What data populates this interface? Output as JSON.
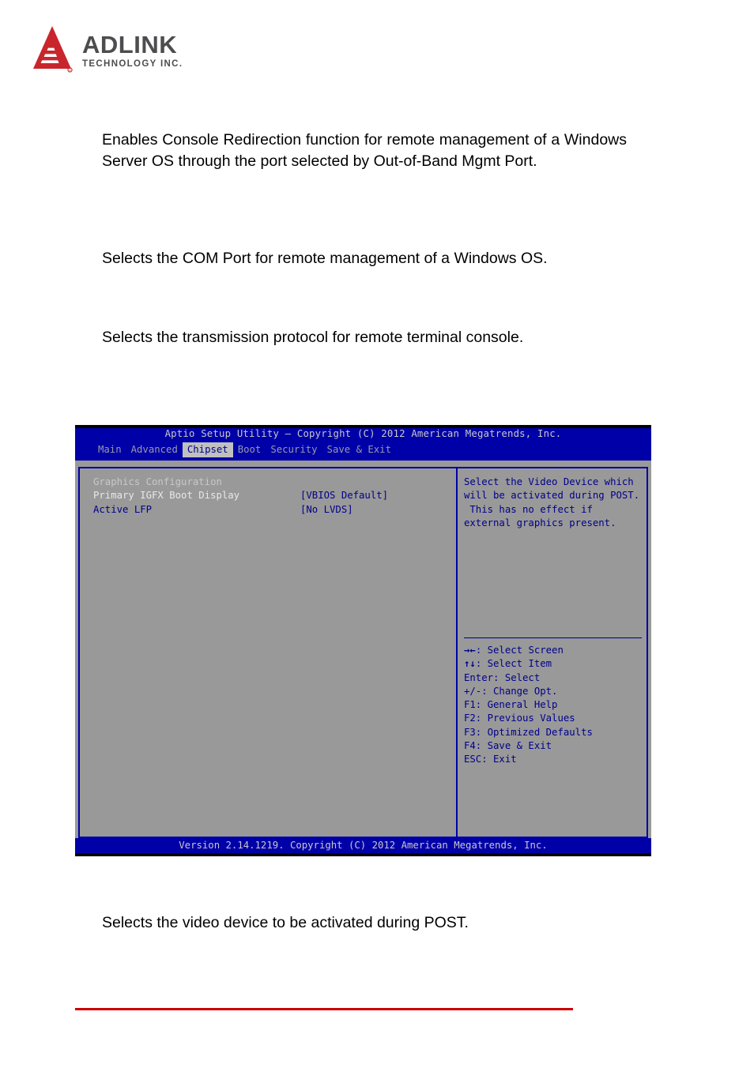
{
  "header": {
    "logo_name": "ADLINK",
    "logo_sub": "TECHNOLOGY INC.",
    "logo_icon": "adlink-triangle-logo",
    "logo_color": "#c8262c"
  },
  "descriptions": {
    "p1": "Enables Console Redirection function for remote management of a Windows Server OS through the port selected by Out-of-Band Mgmt Port.",
    "p2": "Selects the COM Port for remote management of a Windows OS.",
    "p3": "Selects the transmission protocol for remote terminal console.",
    "p4": "Selects the video device to be activated during POST."
  },
  "bios": {
    "title": "Aptio Setup Utility – Copyright (C) 2012 American Megatrends, Inc.",
    "menu": [
      {
        "label": "Main",
        "active": false
      },
      {
        "label": "Advanced",
        "active": false
      },
      {
        "label": "Chipset",
        "active": true
      },
      {
        "label": "Boot",
        "active": false
      },
      {
        "label": "Security",
        "active": false
      },
      {
        "label": "Save & Exit",
        "active": false
      }
    ],
    "section_heading": "Graphics Configuration",
    "options": [
      {
        "label": "Primary IGFX Boot Display",
        "value": "[VBIOS Default]",
        "selected": false
      },
      {
        "label": "Active LFP",
        "value": "[No LVDS]",
        "selected": true
      }
    ],
    "help_lines": [
      "Select the Video Device which",
      "will be activated during POST.",
      " This has no effect if",
      "external graphics present."
    ],
    "shortcuts": [
      {
        "key": "→←",
        "text": ": Select Screen"
      },
      {
        "key": "↑↓",
        "text": ": Select Item"
      },
      {
        "key": "",
        "text": "Enter: Select"
      },
      {
        "key": "",
        "text": "+/-: Change Opt."
      },
      {
        "key": "",
        "text": "F1: General Help"
      },
      {
        "key": "",
        "text": "F2: Previous Values"
      },
      {
        "key": "",
        "text": "F3: Optimized Defaults"
      },
      {
        "key": "",
        "text": "F4: Save & Exit"
      },
      {
        "key": "",
        "text": "ESC: Exit"
      }
    ],
    "footer": "Version 2.14.1219. Copyright (C) 2012 American Megatrends, Inc.",
    "colors": {
      "bar_blue": "#0000a8",
      "panel_gray": "#999999",
      "text_blue": "#00008b",
      "text_light": "#c8c8c8"
    }
  },
  "footer_rule_color": "#cc0000"
}
